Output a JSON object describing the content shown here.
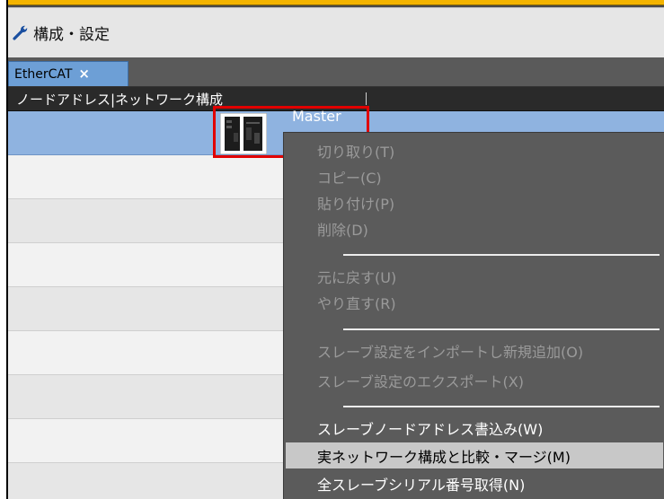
{
  "window": {
    "title": "構成・設定",
    "icon": "wrench-icon"
  },
  "tabs": [
    {
      "label": "EtherCAT",
      "close_glyph": "×"
    }
  ],
  "table": {
    "header": "ノードアドレス|ネットワーク構成",
    "selected_row_label": "Master",
    "device_icon": "controller-device-icon"
  },
  "context_menu": {
    "items": [
      {
        "label": "切り取り(T)",
        "state": "disabled"
      },
      {
        "label": "コピー(C)",
        "state": "disabled"
      },
      {
        "label": "貼り付け(P)",
        "state": "disabled"
      },
      {
        "label": "削除(D)",
        "state": "disabled"
      },
      {
        "label": "元に戻す(U)",
        "state": "disabled"
      },
      {
        "label": "やり直す(R)",
        "state": "disabled"
      },
      {
        "label": "スレーブ設定をインポートし新規追加(O)",
        "state": "disabled"
      },
      {
        "label": "スレーブ設定のエクスポート(X)",
        "state": "disabled"
      },
      {
        "label": "スレーブノードアドレス書込み(W)",
        "state": "enabled"
      },
      {
        "label": "実ネットワーク構成と比較・マージ(M)",
        "state": "hover"
      },
      {
        "label": "全スレーブシリアル番号取得(N)",
        "state": "enabled"
      }
    ]
  },
  "colors": {
    "selection": "#8fb3e0",
    "highlight_box": "#e10000",
    "menu_bg": "#5b5b5b",
    "hover_bg": "#c8c8c8",
    "accent_strip": "#f4b400"
  }
}
